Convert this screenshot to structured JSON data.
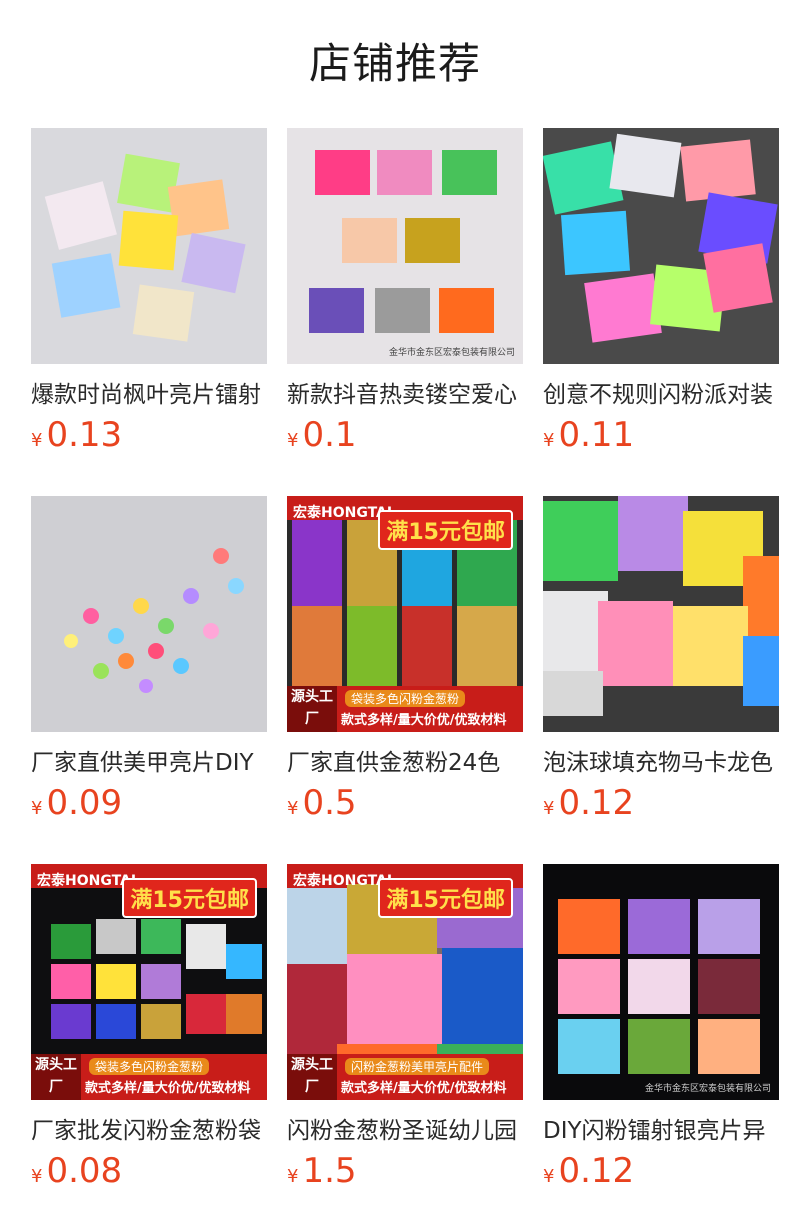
{
  "page": {
    "title": "店铺推荐"
  },
  "colors": {
    "price": "#e8431f",
    "promo_red": "#c81d19"
  },
  "products": [
    {
      "name": "爆款时尚枫叶亮片镭射",
      "currency": "¥",
      "price": "0.13"
    },
    {
      "name": "新款抖音热卖镂空爱心",
      "currency": "¥",
      "price": "0.1"
    },
    {
      "name": "创意不规则闪粉派对装",
      "currency": "¥",
      "price": "0.11"
    },
    {
      "name": "厂家直供美甲亮片DIY",
      "currency": "¥",
      "price": "0.09"
    },
    {
      "name": "厂家直供金葱粉24色",
      "currency": "¥",
      "price": "0.5"
    },
    {
      "name": "泡沫球填充物马卡龙色",
      "currency": "¥",
      "price": "0.12"
    },
    {
      "name": "厂家批发闪粉金葱粉袋",
      "currency": "¥",
      "price": "0.08"
    },
    {
      "name": "闪粉金葱粉圣诞幼儿园",
      "currency": "¥",
      "price": "1.5"
    },
    {
      "name": "DIY闪粉镭射银亮片异",
      "currency": "¥",
      "price": "0.12"
    }
  ],
  "image_text": {
    "brand": "宏泰HONGTAI",
    "badge": "满15元包邮",
    "source_factory": "源头工厂",
    "strip_line1_a": "袋装多色闪粉金葱粉",
    "strip_line1_b": "闪粉金葱粉美甲亮片配件",
    "strip_line2": "款式多样/量大价优/优致材料",
    "watermark": "金华市金东区宏泰包装有限公司"
  }
}
